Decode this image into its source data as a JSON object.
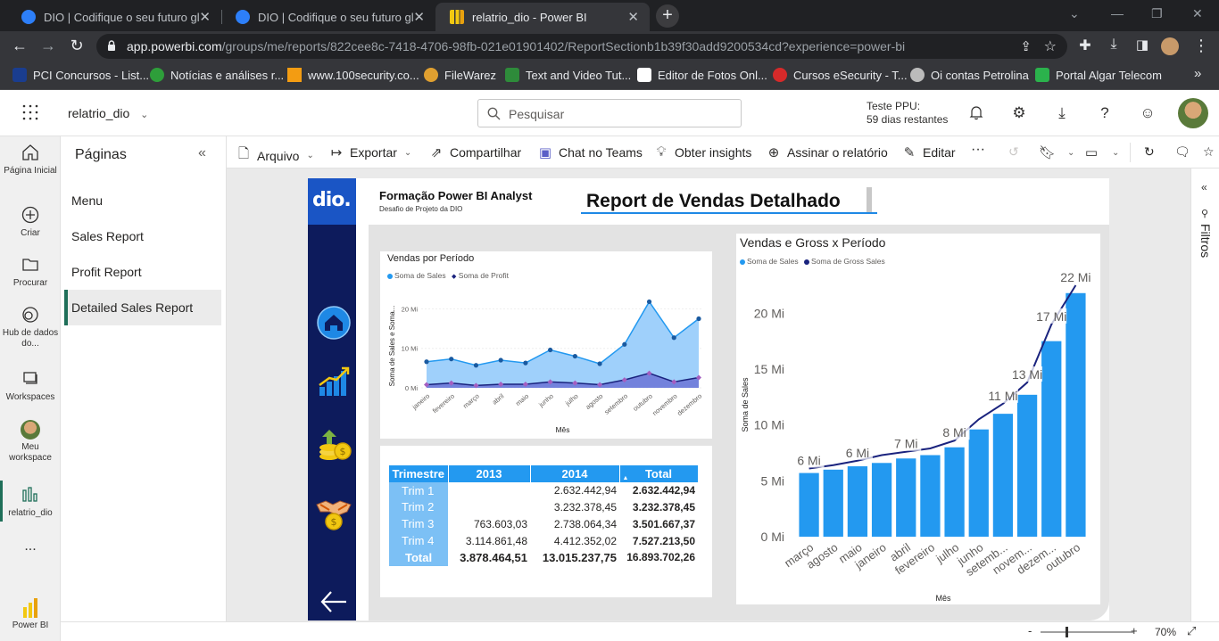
{
  "browser": {
    "tabs": [
      {
        "label": "DIO | Codifique o seu futuro glob",
        "active": false
      },
      {
        "label": "DIO | Codifique o seu futuro glob",
        "active": false
      },
      {
        "label": "relatrio_dio - Power BI",
        "active": true
      }
    ],
    "url_host": "app.powerbi.com",
    "url_path": "/groups/me/reports/822cee8c-7418-4706-98fb-021e01901402/ReportSectionb1b39f30add9200534cd?experience=power-bi",
    "bookmarks": [
      {
        "label": "PCI Concursos - List...",
        "color": "#1a3d8f"
      },
      {
        "label": "Notícias e análises r...",
        "color": "#2e9e3a"
      },
      {
        "label": "www.100security.co...",
        "color": "#f39c12"
      },
      {
        "label": "FileWarez",
        "color": "#e0a030"
      },
      {
        "label": "Text and Video Tut...",
        "color": "#2e8b3a"
      },
      {
        "label": "Editor de Fotos Onl...",
        "color": "#ffffff"
      },
      {
        "label": "Cursos eSecurity - T...",
        "color": "#d62a2a"
      },
      {
        "label": "Oi contas Petrolina",
        "color": "#bbbbbb"
      },
      {
        "label": "Portal Algar Telecom",
        "color": "#2bb24c"
      }
    ],
    "more_bookmarks": "»"
  },
  "header": {
    "report_name": "relatrio_dio",
    "search_placeholder": "Pesquisar",
    "trial_line1": "Teste PPU:",
    "trial_line2": "59 dias restantes"
  },
  "leftnav": [
    {
      "label": "Página Inicial",
      "icon": "home-icon"
    },
    {
      "label": "Criar",
      "icon": "plus-circle-icon"
    },
    {
      "label": "Procurar",
      "icon": "folder-icon"
    },
    {
      "label": "Hub de dados do...",
      "icon": "data-hub-icon"
    },
    {
      "label": "Workspaces",
      "icon": "workspaces-icon"
    },
    {
      "label": "Meu workspace",
      "icon": "avatar-icon"
    },
    {
      "label": "relatrio_dio",
      "icon": "report-icon"
    },
    {
      "label": "...",
      "icon": "more-icon"
    },
    {
      "label": "Power BI",
      "icon": "powerbi-logo-icon"
    }
  ],
  "pages_pane": {
    "title": "Páginas",
    "pages": [
      "Menu",
      "Sales Report",
      "Profit Report",
      "Detailed Sales Report"
    ],
    "selected": "Detailed Sales Report"
  },
  "actions": [
    "Arquivo",
    "Exportar",
    "Compartilhar",
    "Chat no Teams",
    "Obter insights",
    "Assinar o relatório",
    "Editar"
  ],
  "filters_label": "Filtros",
  "status": {
    "zoom": "70%"
  },
  "report": {
    "brand": "dio.",
    "header_title": "Formação Power BI Analyst",
    "header_sub": "Desafio de Projeto da DIO",
    "main_title": "Report de Vendas Detalhado",
    "accent": "#2399f0",
    "sidebar_color": "#0d1b5c"
  },
  "line_chart": {
    "title": "Vendas por Período",
    "legend": [
      {
        "name": "Soma de  Sales",
        "color": "#2399f0"
      },
      {
        "name": "Soma de Profit",
        "color": "#1a237e"
      }
    ],
    "ylabel": "Soma de Sales e Soma...",
    "xlabel": "Mês",
    "yticks": [
      "20 Mi",
      "10 Mi",
      "0 Mi"
    ]
  },
  "matrix": {
    "headers": [
      "Trimestre",
      "2013",
      "2014",
      "Total"
    ],
    "rows": [
      {
        "label": "Trim 1",
        "y2013": "",
        "y2014": "2.632.442,94",
        "total": "2.632.442,94"
      },
      {
        "label": "Trim 2",
        "y2013": "",
        "y2014": "3.232.378,45",
        "total": "3.232.378,45"
      },
      {
        "label": "Trim 3",
        "y2013": "763.603,03",
        "y2014": "2.738.064,34",
        "total": "3.501.667,37"
      },
      {
        "label": "Trim 4",
        "y2013": "3.114.861,48",
        "y2014": "4.412.352,02",
        "total": "7.527.213,50"
      }
    ],
    "total_row": {
      "label": "Total",
      "y2013": "3.878.464,51",
      "y2014": "13.015.237,75",
      "total": "16.893.702,26"
    }
  },
  "bar_chart": {
    "title": "Vendas e Gross x Período",
    "legend": [
      {
        "name": "Soma de  Sales",
        "color": "#2399f0"
      },
      {
        "name": "Soma de Gross Sales",
        "color": "#1a237e"
      }
    ],
    "ylabel": "Soma de Sales",
    "xlabel": "Mês",
    "yticks": [
      "20 Mi",
      "15 Mi",
      "10 Mi",
      "5 Mi",
      "0 Mi"
    ]
  },
  "chart_data": [
    {
      "type": "line",
      "title": "Vendas por Período",
      "categories": [
        "janeiro",
        "fevereiro",
        "março",
        "abril",
        "maio",
        "junho",
        "julho",
        "agosto",
        "setembro",
        "outubro",
        "novembro",
        "dezembro"
      ],
      "series": [
        {
          "name": "Soma de  Sales",
          "values": [
            6.6,
            7.3,
            5.7,
            7.0,
            6.3,
            9.6,
            8.0,
            6.1,
            11.0,
            21.8,
            12.7,
            17.5
          ]
        },
        {
          "name": "Soma de Profit",
          "values": [
            0.8,
            1.2,
            0.6,
            0.9,
            0.9,
            1.5,
            1.2,
            0.8,
            2.0,
            3.7,
            1.5,
            2.6
          ]
        }
      ],
      "ylabel": "Soma de Sales e Soma...",
      "xlabel": "Mês",
      "ylim": [
        0,
        20
      ],
      "yticks": [
        "0 Mi",
        "10 Mi",
        "20 Mi"
      ]
    },
    {
      "type": "bar",
      "title": "Vendas e Gross x Período",
      "categories": [
        "março",
        "agosto",
        "maio",
        "janeiro",
        "abril",
        "fevereiro",
        "julho",
        "junho",
        "setemb...",
        "novem...",
        "dezem...",
        "outubro"
      ],
      "series": [
        {
          "name": "Soma de  Sales",
          "values": [
            5.7,
            6.0,
            6.3,
            6.6,
            7.0,
            7.3,
            8.0,
            9.6,
            11.0,
            12.7,
            17.5,
            21.8
          ]
        },
        {
          "name": "Soma de Gross Sales",
          "values": [
            6.1,
            6.4,
            6.8,
            7.3,
            7.6,
            7.9,
            8.6,
            10.5,
            11.9,
            13.8,
            19.0,
            22.5
          ]
        }
      ],
      "data_labels": [
        "6 Mi",
        "6 Mi",
        "7 Mi",
        "8 Mi",
        "11 Mi",
        "13 Mi",
        "17 Mi",
        "22 Mi"
      ],
      "ylabel": "Soma de Sales",
      "xlabel": "Mês",
      "ylim": [
        0,
        22
      ],
      "yticks": [
        "0 Mi",
        "5 Mi",
        "10 Mi",
        "15 Mi",
        "20 Mi"
      ]
    }
  ]
}
